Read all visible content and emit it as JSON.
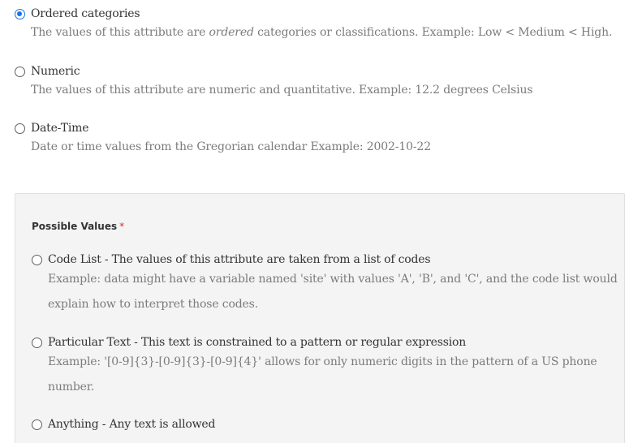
{
  "attribute_types": [
    {
      "label": "Ordered categories",
      "description_before": "The values of this attribute are ",
      "description_emphasis": "ordered",
      "description_after": " categories or classifications. Example: Low < Medium < High.",
      "selected": true
    },
    {
      "label": "Numeric",
      "description": "The values of this attribute are numeric and quantitative. Example: 12.2 degrees Celsius",
      "selected": false
    },
    {
      "label": "Date-Time",
      "description": "Date or time values from the Gregorian calendar Example: 2002-10-22",
      "selected": false
    }
  ],
  "possible_values": {
    "title": "Possible Values",
    "required_marker": "*",
    "options": [
      {
        "label": "Code List - The values of this attribute are taken from a list of codes",
        "description_line1": "Example: data might have a variable named 'site' with values 'A', 'B', and 'C', and the code list would",
        "description_line2": "explain how to interpret those codes.",
        "selected": false
      },
      {
        "label": "Particular Text - This text is constrained to a pattern or regular expression",
        "description_line1": "Example: '[0-9]{3}-[0-9]{3}-[0-9]{4}' allows for only numeric digits in the pattern of a US phone",
        "description_line2": "number.",
        "selected": false
      },
      {
        "label": "Anything - Any text is allowed",
        "selected": false
      }
    ]
  },
  "colors": {
    "accent": "#1a73e8",
    "required": "#d93025",
    "panel_background": "#f4f4f4",
    "description_text": "#7b7b7b"
  }
}
